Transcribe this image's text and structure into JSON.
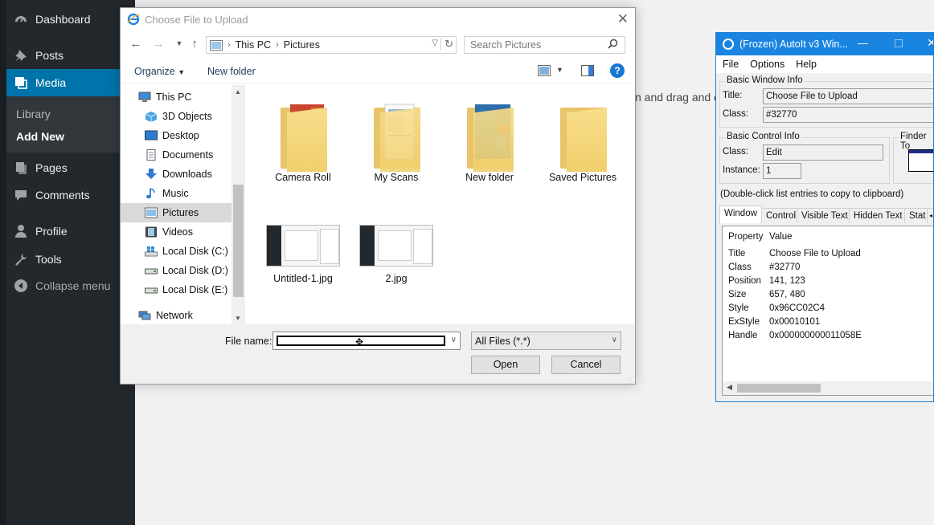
{
  "wp": {
    "menu": {
      "dashboard": "Dashboard",
      "posts": "Posts",
      "media": "Media",
      "pages": "Pages",
      "comments": "Comments",
      "profile": "Profile",
      "tools": "Tools",
      "collapse": "Collapse menu"
    },
    "media_sub": {
      "library": "Library",
      "add_new": "Add New"
    },
    "page_hint": "n and drag and dro"
  },
  "dialog": {
    "title": "Choose File to Upload",
    "breadcrumb": [
      "This PC",
      "Pictures"
    ],
    "search_placeholder": "Search Pictures",
    "organize": "Organize",
    "new_folder": "New folder",
    "nav": [
      "This PC",
      "3D Objects",
      "Desktop",
      "Documents",
      "Downloads",
      "Music",
      "Pictures",
      "Videos",
      "Local Disk (C:)",
      "Local Disk (D:)",
      "Local Disk (E:)",
      "Network"
    ],
    "files": [
      "Camera Roll",
      "My Scans",
      "New folder",
      "Saved Pictures",
      "Untitled-1.jpg",
      "2.jpg"
    ],
    "file_name_label": "File name:",
    "file_name_value": "",
    "file_type": "All Files (*.*)",
    "open": "Open",
    "cancel": "Cancel"
  },
  "autoit": {
    "title": "(Frozen) AutoIt v3 Win...",
    "menu": [
      "File",
      "Options",
      "Help"
    ],
    "basic_window_info": "Basic Window Info",
    "title_label": "Title:",
    "title_value": "Choose File to Upload",
    "class_label": "Class:",
    "class_value": "#32770",
    "basic_control_info": "Basic Control Info",
    "ctrl_class_label": "Class:",
    "ctrl_class_value": "Edit",
    "instance_label": "Instance:",
    "instance_value": "1",
    "finder_tool": "Finder To",
    "hint": "(Double-click list entries to copy to clipboard)",
    "tabs": [
      "Window",
      "Control",
      "Visible Text",
      "Hidden Text",
      "Stat"
    ],
    "columns": [
      "Property",
      "Value"
    ],
    "rows": [
      [
        "Title",
        "Choose File to Upload"
      ],
      [
        "Class",
        "#32770"
      ],
      [
        "Position",
        "141, 123"
      ],
      [
        "Size",
        "657, 480"
      ],
      [
        "Style",
        "0x96CC02C4"
      ],
      [
        "ExStyle",
        "0x00010101"
      ],
      [
        "Handle",
        "0x000000000011058E"
      ]
    ]
  },
  "colors": {
    "wp_sidebar": "#23282d",
    "wp_active": "#0073aa",
    "autoit_title": "#1a85e0"
  }
}
